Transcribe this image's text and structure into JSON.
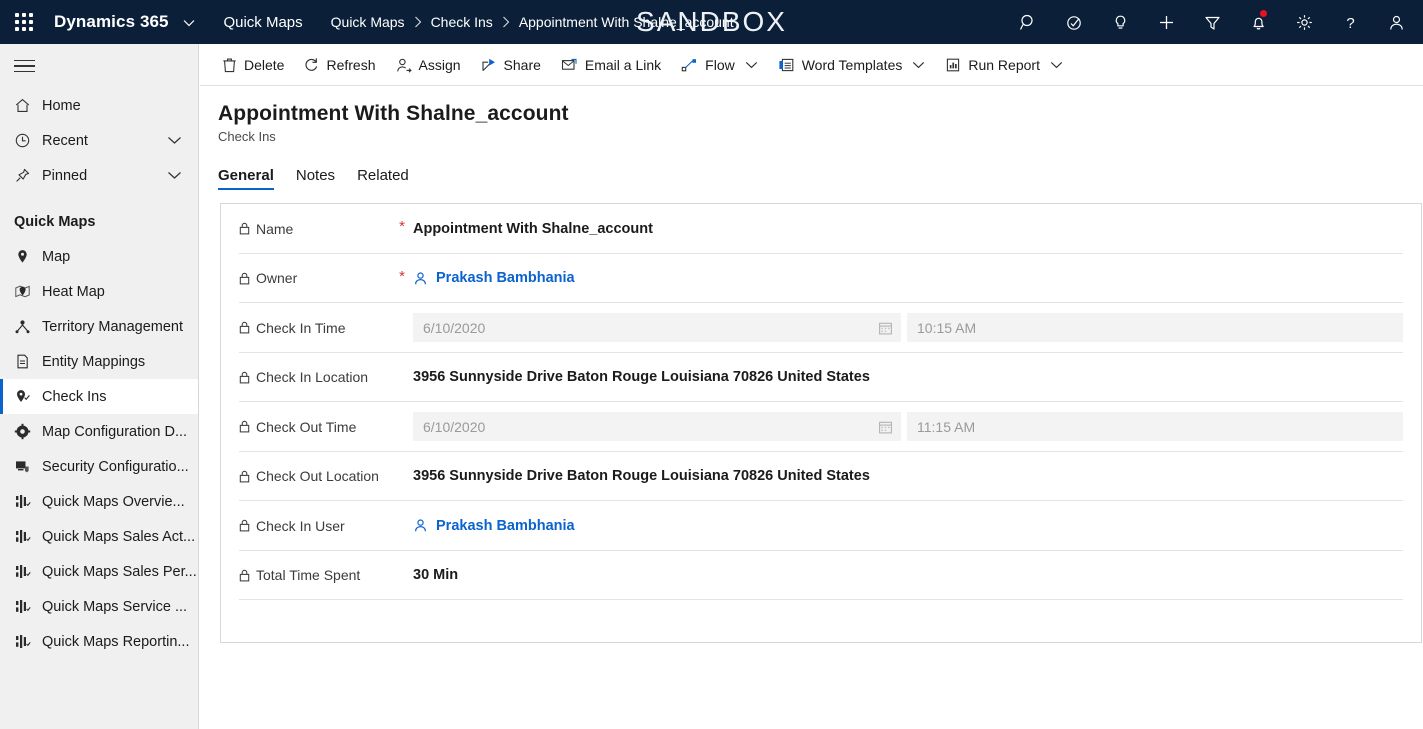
{
  "topbar": {
    "waffle_label": "app-launcher",
    "brand": "Dynamics 365",
    "app_name": "Quick Maps",
    "sandbox_label": "SANDBOX",
    "breadcrumb": [
      {
        "label": "Quick Maps"
      },
      {
        "label": "Check Ins"
      },
      {
        "label": "Appointment With Shalne_account"
      }
    ],
    "icons": [
      {
        "name": "search-icon",
        "title": "Search"
      },
      {
        "name": "diagnostics-icon",
        "title": "Diagnostics"
      },
      {
        "name": "lightbulb-icon",
        "title": "Insights"
      },
      {
        "name": "plus-icon",
        "title": "Quick Create"
      },
      {
        "name": "filter-icon",
        "title": "Filter"
      },
      {
        "name": "notification-bell-icon",
        "title": "Notifications",
        "badge": true
      },
      {
        "name": "gear-icon",
        "title": "Settings"
      },
      {
        "name": "help-icon",
        "title": "Help"
      },
      {
        "name": "user-account-icon",
        "title": "Account"
      }
    ]
  },
  "sidebar": {
    "hamburger_label": "Site Map",
    "top_items": [
      {
        "label": "Home",
        "icon": "home-icon",
        "chevron": false
      },
      {
        "label": "Recent",
        "icon": "clock-icon",
        "chevron": true
      },
      {
        "label": "Pinned",
        "icon": "pin-icon",
        "chevron": true
      }
    ],
    "group_title": "Quick Maps",
    "group_items": [
      {
        "label": "Map",
        "icon": "map-pin-icon",
        "selected": false
      },
      {
        "label": "Heat Map",
        "icon": "heat-map-icon",
        "selected": false
      },
      {
        "label": "Territory Management",
        "icon": "territory-icon",
        "selected": false
      },
      {
        "label": "Entity Mappings",
        "icon": "document-icon",
        "selected": false
      },
      {
        "label": "Check Ins",
        "icon": "check-in-pin-icon",
        "selected": true
      },
      {
        "label": "Map Configuration D...",
        "icon": "gear-pin-icon",
        "selected": false
      },
      {
        "label": "Security Configuratio...",
        "icon": "security-icon",
        "selected": false
      },
      {
        "label": "Quick Maps Overvie...",
        "icon": "dashboard-icon",
        "selected": false
      },
      {
        "label": "Quick Maps Sales Act...",
        "icon": "dashboard-icon",
        "selected": false
      },
      {
        "label": "Quick Maps Sales Per...",
        "icon": "dashboard-icon",
        "selected": false
      },
      {
        "label": "Quick Maps Service ...",
        "icon": "dashboard-icon",
        "selected": false
      },
      {
        "label": "Quick Maps Reportin...",
        "icon": "dashboard-icon",
        "selected": false
      }
    ]
  },
  "commandbar": [
    {
      "label": "Delete",
      "icon": "trash-icon",
      "chevron": false
    },
    {
      "label": "Refresh",
      "icon": "refresh-icon",
      "chevron": false
    },
    {
      "label": "Assign",
      "icon": "assign-user-icon",
      "chevron": false
    },
    {
      "label": "Share",
      "icon": "share-icon",
      "chevron": false
    },
    {
      "label": "Email a Link",
      "icon": "email-link-icon",
      "chevron": false
    },
    {
      "label": "Flow",
      "icon": "flow-icon",
      "chevron": true
    },
    {
      "label": "Word Templates",
      "icon": "word-template-icon",
      "chevron": true
    },
    {
      "label": "Run Report",
      "icon": "run-report-icon",
      "chevron": true
    }
  ],
  "record": {
    "title": "Appointment With Shalne_account",
    "subtitle": "Check Ins"
  },
  "tabs": [
    {
      "label": "General",
      "active": true
    },
    {
      "label": "Notes",
      "active": false
    },
    {
      "label": "Related",
      "active": false
    }
  ],
  "form": {
    "required_marker": "*",
    "fields": [
      {
        "label": "Name",
        "type": "text",
        "value": "Appointment With Shalne_account",
        "required": true,
        "locked": true
      },
      {
        "label": "Owner",
        "type": "lookup",
        "value": "Prakash Bambhania",
        "required": true,
        "locked": true
      },
      {
        "label": "Check In Time",
        "type": "datetime",
        "date": "6/10/2020",
        "time": "10:15 AM",
        "required": false,
        "locked": true,
        "disabled": true
      },
      {
        "label": "Check In Location",
        "type": "text",
        "value": "3956 Sunnyside Drive Baton Rouge Louisiana 70826 United States",
        "required": false,
        "locked": true
      },
      {
        "label": "Check Out Time",
        "type": "datetime",
        "date": "6/10/2020",
        "time": "11:15 AM",
        "required": false,
        "locked": true,
        "disabled": true
      },
      {
        "label": "Check Out Location",
        "type": "text",
        "value": "3956 Sunnyside Drive Baton Rouge Louisiana 70826 United States",
        "required": false,
        "locked": true
      },
      {
        "label": "Check In User",
        "type": "lookup",
        "value": "Prakash Bambhania",
        "required": false,
        "locked": true
      },
      {
        "label": "Total Time Spent",
        "type": "text",
        "value": "30 Min",
        "required": false,
        "locked": true
      }
    ]
  },
  "colors": {
    "navbar": "#0b1f38",
    "accent": "#0b63ce",
    "sidebar_bg": "#f0f0f0",
    "required_red": "#d13438",
    "badge_red": "#e81123",
    "disabled_field": "#f3f3f3"
  }
}
